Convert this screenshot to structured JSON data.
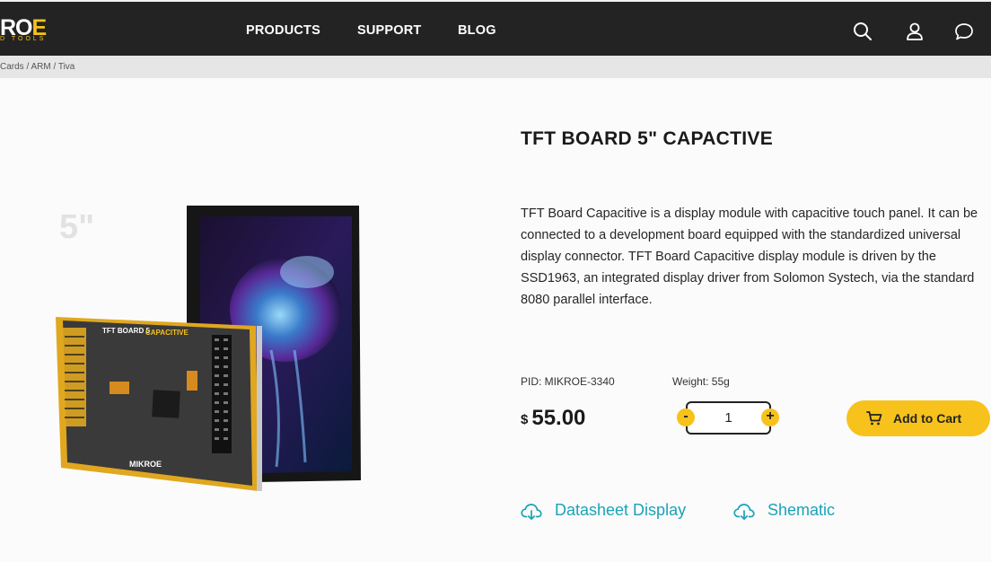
{
  "header": {
    "logo": {
      "letters_white": "RO",
      "letter_accent": "E",
      "tagline": "D TOOLS"
    },
    "nav": [
      "PRODUCTS",
      "SUPPORT",
      "BLOG"
    ],
    "icons": [
      "search-icon",
      "user-icon",
      "chat-icon"
    ]
  },
  "breadcrumb": "Cards / ARM / Tiva",
  "product": {
    "image": {
      "size_badge": "5\"",
      "board_label": "TFT BOARD 5",
      "board_sublabel": "CAPACITIVE",
      "board_brand": "MIKROE"
    },
    "title": "TFT BOARD 5\" CAPACTIVE",
    "description": "TFT Board Capacitive is a display module with capacitive touch panel. It can be connected to a development board equipped with the standardized universal display connector. TFT Board Capacitive display module is driven by the SSD1963, an integrated display driver from Solomon Systech, via the standard 8080 parallel interface.",
    "pid": "PID:  MIKROE-3340",
    "weight": "Weight: 55g",
    "currency": "$",
    "price": "55.00",
    "quantity": "1",
    "minus_label": "-",
    "plus_label": "+",
    "add_to_cart": "Add to Cart",
    "downloads": [
      "Datasheet Display",
      "Shematic"
    ]
  },
  "colors": {
    "accent": "#f7c21b",
    "header_bg": "#232323",
    "link": "#1aa3b8"
  }
}
